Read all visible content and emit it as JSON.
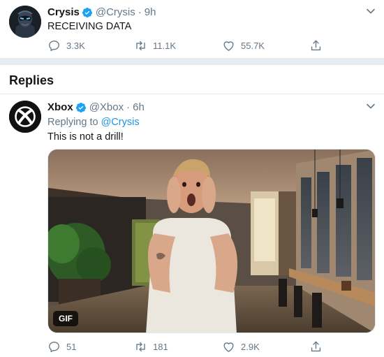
{
  "original_tweet": {
    "display_name": "Crysis",
    "handle": "@Crysis",
    "separator": "·",
    "time": "9h",
    "text": "RECEIVING DATA",
    "reply_count": "3.3K",
    "retweet_count": "11.1K",
    "like_count": "55.7K"
  },
  "replies_section": {
    "title": "Replies"
  },
  "reply_tweet": {
    "display_name": "Xbox",
    "handle": "@Xbox",
    "separator": "·",
    "time": "6h",
    "replying_to_label": "Replying to",
    "replying_to_handle": "@Crysis",
    "text": "This is not a drill!",
    "media_badge": "GIF",
    "reply_count": "51",
    "retweet_count": "181",
    "like_count": "2.9K"
  },
  "colors": {
    "verified_blue": "#1da1f2",
    "link_blue": "#1b95e0",
    "muted_gray": "#657786",
    "divider": "#e6ecf0"
  },
  "icons": [
    "verified-badge-icon",
    "chevron-down-icon",
    "reply-icon",
    "retweet-icon",
    "like-icon",
    "share-icon",
    "xbox-logo-icon"
  ]
}
